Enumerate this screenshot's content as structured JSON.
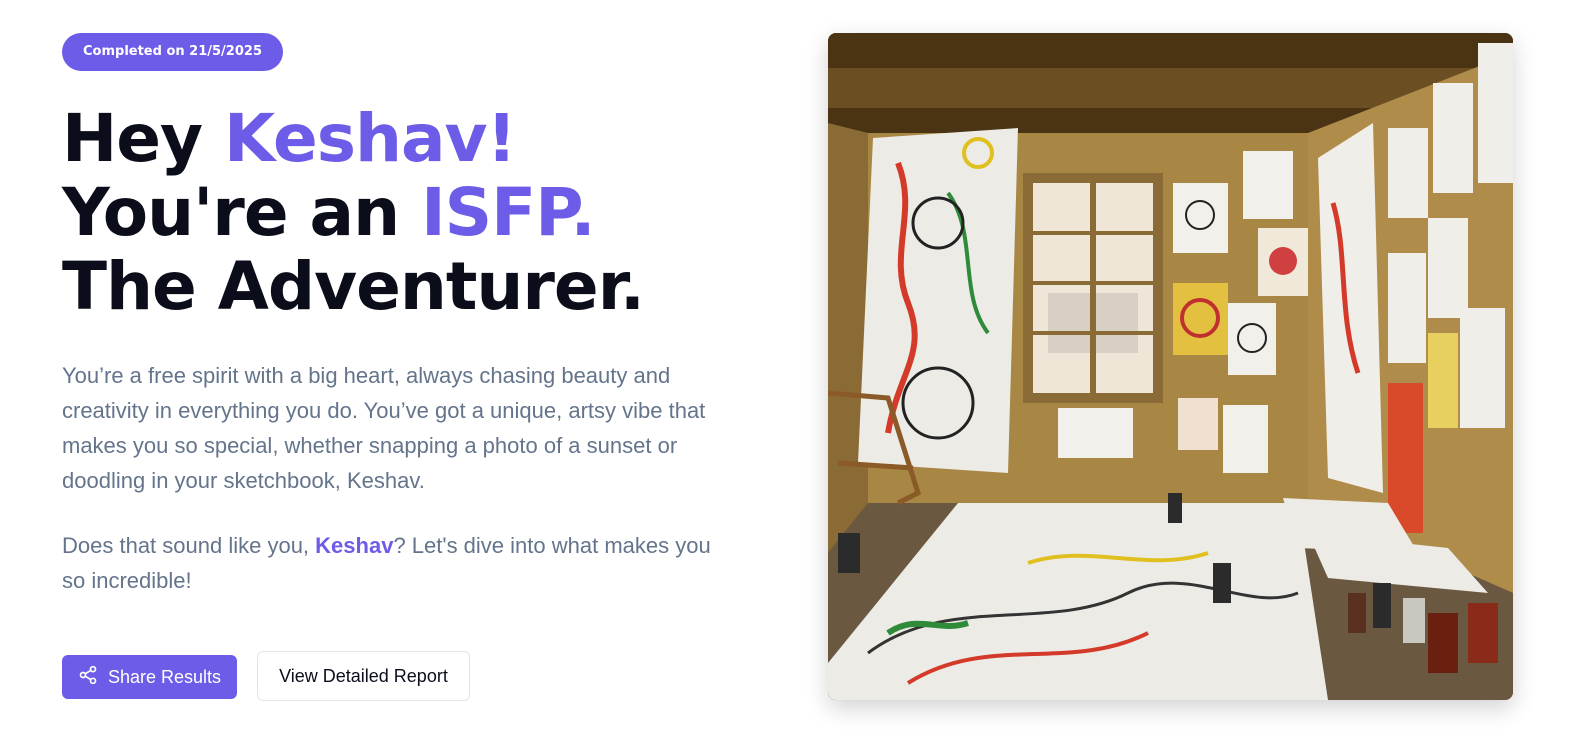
{
  "badge": {
    "label": "Completed on 21/5/2025"
  },
  "headline": {
    "line1_prefix": "Hey ",
    "line1_name": "Keshav!",
    "line2_prefix": "You're an ",
    "line2_type": "ISFP.",
    "line3": "The Adventurer."
  },
  "description": "You’re a free spirit with a big heart, always chasing beauty and creativity in everything you do. You’ve got a unique, artsy vibe that makes you so special, whether snapping a photo of a sunset or doodling in your sketchbook, Keshav.",
  "question": {
    "prefix": "Does that sound like you, ",
    "name": "Keshav",
    "suffix": "? Let's dive into what makes you so incredible!"
  },
  "actions": {
    "share_label": "Share Results",
    "share_icon": "share-icon",
    "report_label": "View Detailed Report"
  },
  "colors": {
    "accent": "#6c5ce7",
    "heading": "#0b0d1a",
    "body_text": "#64748b"
  }
}
